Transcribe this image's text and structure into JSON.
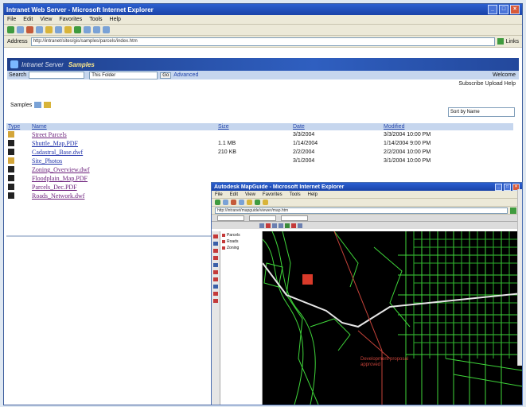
{
  "browser": {
    "title": "Intranet Web Server - Microsoft Internet Explorer",
    "menu": [
      "File",
      "Edit",
      "View",
      "Favorites",
      "Tools",
      "Help"
    ],
    "address_label": "Address",
    "address": "http://intranet/sites/gis/samples/parcels/index.htm",
    "links_label": "Links"
  },
  "site": {
    "brand": "Intranet Server",
    "title": "Samples",
    "search_label": "Search",
    "search_value": "",
    "search_scope": "This Folder",
    "go_label": "Go",
    "search_link": "Advanced",
    "user_info": "Welcome",
    "advanced_links": "Subscribe  Upload  Help",
    "folder_path_label": "Samples",
    "sort_select": "Sort by Name"
  },
  "table": {
    "headers": [
      "Type",
      "Name",
      "Size",
      "Date",
      "Modified"
    ],
    "rows": [
      {
        "icon": "folder",
        "name": "Street Parcels",
        "visited": true,
        "size": "",
        "date": "3/3/2004",
        "modified": "3/3/2004 10:00 PM"
      },
      {
        "icon": "doc",
        "name": "Shuttle_Map.PDF",
        "visited": false,
        "size": "1.1 MB",
        "date": "1/14/2004",
        "modified": "1/14/2004 9:00 PM"
      },
      {
        "icon": "doc",
        "name": "Cadastral_Base.dwf",
        "visited": false,
        "size": "210 KB",
        "date": "2/2/2004",
        "modified": "2/2/2004 10:00 PM"
      },
      {
        "icon": "folder",
        "name": "Site_Photos",
        "visited": false,
        "size": "",
        "date": "3/1/2004",
        "modified": "3/1/2004 10:00 PM"
      },
      {
        "icon": "doc",
        "name": "Zoning_Overview.dwf",
        "visited": true,
        "size": "",
        "date": "",
        "modified": ""
      },
      {
        "icon": "doc",
        "name": "Floodplain_Map.PDF",
        "visited": true,
        "size": "",
        "date": "",
        "modified": ""
      },
      {
        "icon": "doc",
        "name": "Parcels_Dec.PDF",
        "visited": true,
        "size": "",
        "date": "",
        "modified": ""
      },
      {
        "icon": "doc",
        "name": "Roads_Network.dwf",
        "visited": true,
        "size": "",
        "date": "",
        "modified": ""
      }
    ]
  },
  "viewer": {
    "title": "Autodesk MapGuide - Microsoft Internet Explorer",
    "menu": [
      "File",
      "Edit",
      "View",
      "Favorites",
      "Tools",
      "Help"
    ],
    "address": "http://intranet/mapguide/viewer/map.htm",
    "layers": [
      "Parcels",
      "Roads",
      "Zoning"
    ],
    "map_label": "Development proposal approved"
  },
  "colors": {
    "map_background": "#000000",
    "parcels": "#3fd63a",
    "roads": "#e6e6e6",
    "marker": "#d83a2a"
  }
}
